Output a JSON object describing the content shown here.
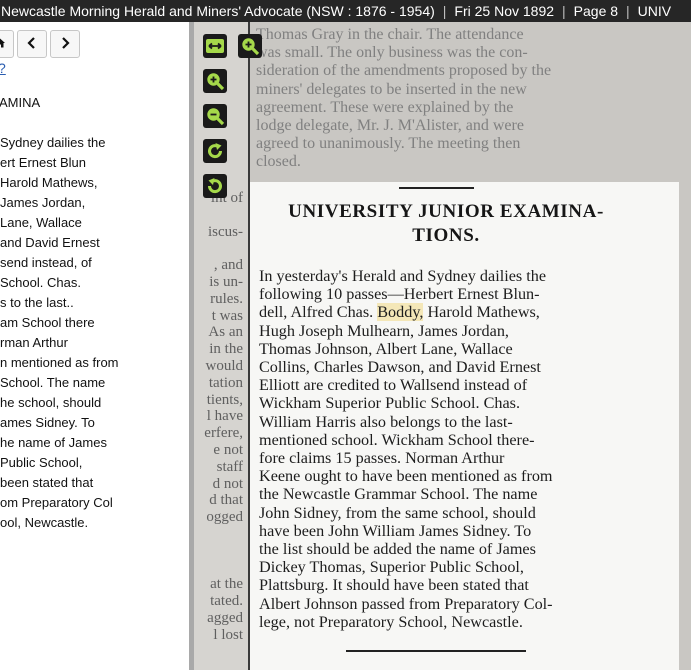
{
  "header": {
    "publication": "Newcastle Morning Herald and Miners' Advocate (NSW : 1876 - 1954)",
    "date": "Fri 25 Nov 1892",
    "page": "Page 8",
    "extra": "UNIV"
  },
  "sidebar": {
    "nav": {
      "back_icon": "home-icon",
      "prev_icon": "chevron-left-icon",
      "next_icon": "chevron-right-icon"
    },
    "help_link": "?",
    "title_fragment": "AMINA",
    "ocr_lines": [
      " Sydney dailies the",
      "ert Ernest Blun",
      "Harold Mathews,",
      "James Jordan,",
      "Lane, Wallace",
      "and David Ernest",
      "send instead, of",
      " School. Chas.",
      "s to the last..",
      "am School there",
      "rman Arthur",
      "n mentioned as from",
      "School. The name",
      "he school, should",
      "ames Sidney. To",
      "he name of James",
      " Public School,",
      " been stated that",
      "om Preparatory Col",
      "ool, Newcastle."
    ]
  },
  "viewer": {
    "tools": [
      "fit-width-icon",
      "zoom-in-icon",
      "zoom-in-icon",
      "zoom-out-icon",
      "rotate-clockwise-icon",
      "rotate-counterclockwise-icon"
    ],
    "accent_color": "#a5d94a",
    "top_text": [
      "Thomas Gray in the chair. The attendance",
      "was small. The only business was the con-",
      "sideration of the amendments proposed by the",
      "miners' delegates to be inserted in the new",
      "agreement. These were explained by the",
      "lodge delegate, Mr. J. M'Alister, and were",
      "agreed to unanimously. The meeting then",
      "closed."
    ],
    "left_column_text": [
      "",
      "",
      "",
      "",
      "",
      "",
      "",
      "",
      "",
      "",
      "",
      "",
      "int of",
      "",
      "iscus-",
      "",
      ", and",
      "is un-",
      "rules.",
      "t was",
      "As an",
      "in the",
      "would",
      "tation",
      "tients,",
      "l have",
      "erfere,",
      "e not",
      " staff",
      "d not",
      "d that",
      "ogged",
      "",
      "",
      "",
      "at the",
      "tated.",
      "agged",
      "l lost"
    ],
    "article": {
      "heading_line1": "UNIVERSITY JUNIOR EXAMINA-",
      "heading_line2": "TIONS.",
      "body_lines": [
        "In yesterday's Herald and Sydney dailies the",
        "following 10 passes—Herbert Ernest Blun-",
        "dell, Alfred Chas. Boddy, Harold Mathews,",
        "Hugh Joseph Mulhearn, James Jordan,",
        "Thomas Johnson, Albert Lane, Wallace",
        "Collins, Charles Dawson, and David Ernest",
        "Elliott are credited to Wallsend instead of",
        "Wickham Superior Public School. Chas.",
        "William Harris also belongs to the last-",
        "mentioned school. Wickham School there-",
        "fore claims 15 passes. Norman Arthur",
        "Keene ought to have been mentioned as from",
        "the Newcastle Grammar School. The name",
        "John Sidney, from the same school, should",
        "have been John William James Sidney. To",
        "the list should be added the name of James",
        "Dickey Thomas, Superior Public School,",
        "Plattsburg. It should have been stated that",
        "Albert Johnson passed from Preparatory Col-",
        "lege, not Preparatory School, Newcastle."
      ],
      "highlighted_word": "Boddy,",
      "highlight_color": "#f4e7b8"
    }
  }
}
